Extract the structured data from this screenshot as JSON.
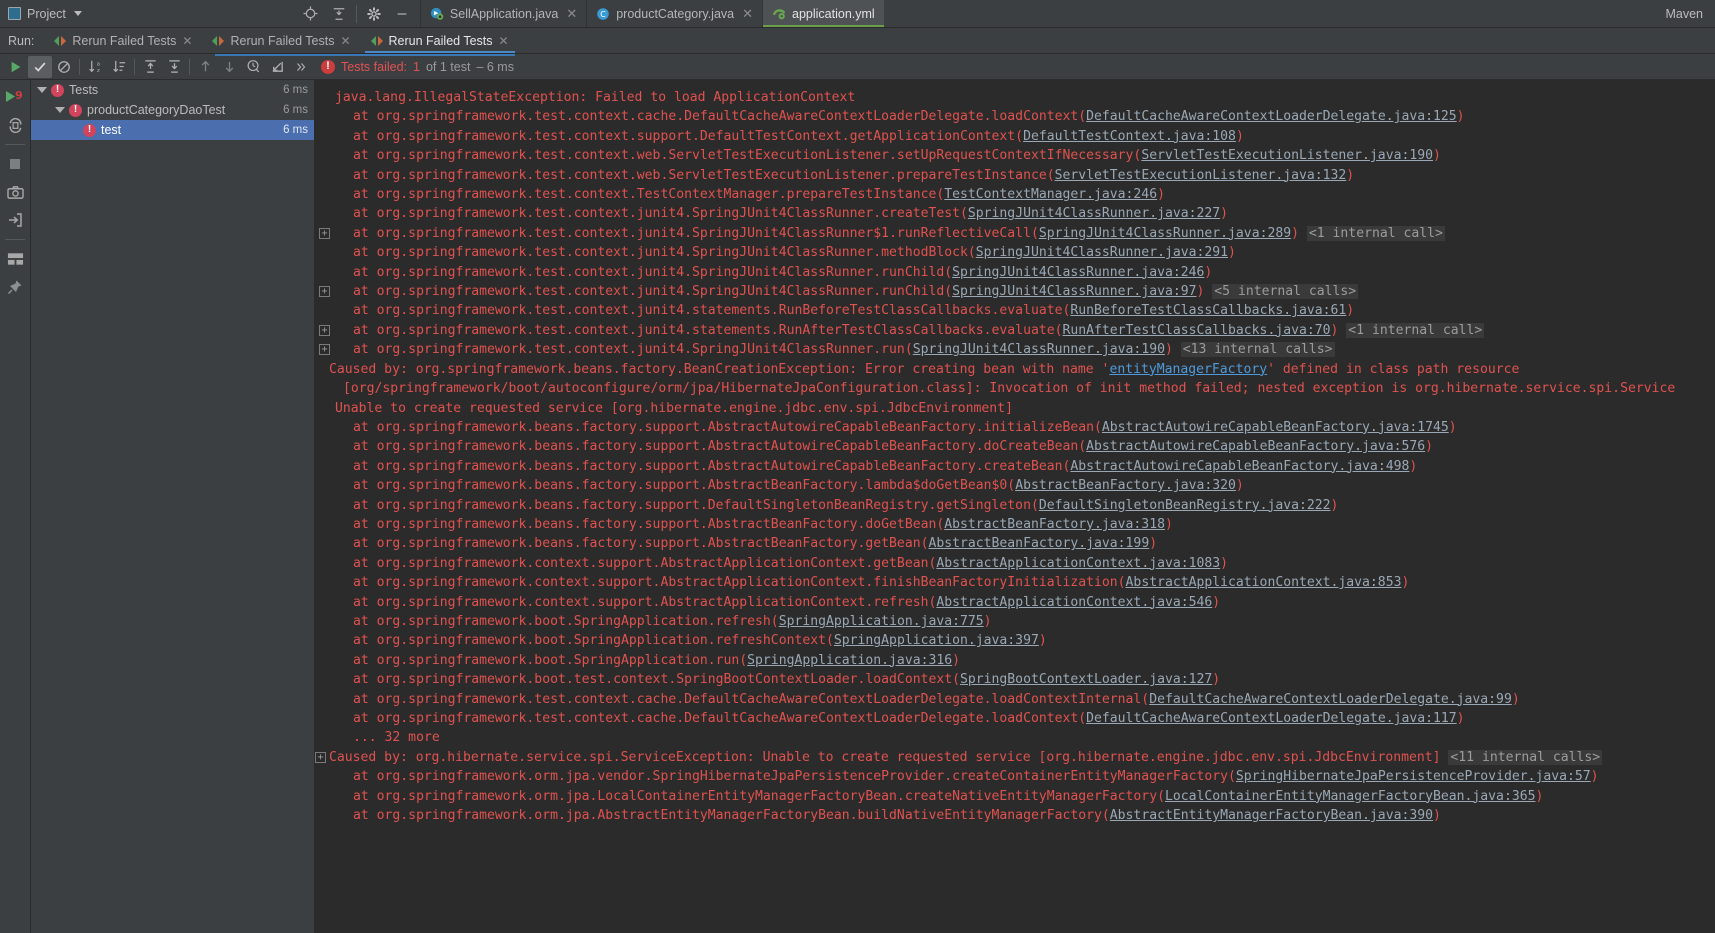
{
  "window": {
    "project_button": "Project",
    "maven_label": "Maven"
  },
  "top_icons": [
    {
      "name": "locate-icon",
      "glyph": "target"
    },
    {
      "name": "collapse-all-icon",
      "glyph": "collapse"
    },
    {
      "name": "settings-gear-icon",
      "glyph": "gear"
    },
    {
      "name": "hide-icon",
      "glyph": "minus"
    }
  ],
  "editor_tabs": [
    {
      "label": "SellApplication.java",
      "icon": "spring-boot-class-icon",
      "active": false,
      "closable": true
    },
    {
      "label": "productCategory.java",
      "icon": "java-class-icon",
      "active": false,
      "closable": true
    },
    {
      "label": "application.yml",
      "icon": "spring-yaml-icon",
      "active": true,
      "closable": false
    }
  ],
  "run_panel": {
    "label": "Run:",
    "tabs": [
      {
        "label": "Rerun Failed Tests",
        "active": false,
        "closable": true
      },
      {
        "label": "Rerun Failed Tests",
        "active": false,
        "closable": true
      },
      {
        "label": "Rerun Failed Tests",
        "active": true,
        "closable": true
      }
    ]
  },
  "toolbar": {
    "buttons": [
      {
        "name": "rerun-button",
        "glyph": "play",
        "selected": false
      },
      {
        "name": "show-passed-toggle",
        "glyph": "check",
        "selected": true
      },
      {
        "name": "show-ignored-toggle",
        "glyph": "no-entry",
        "selected": false
      },
      {
        "name": "sort-alphabetically-button",
        "glyph": "sort-az",
        "selected": false
      },
      {
        "name": "sort-by-duration-button",
        "glyph": "sort-duration",
        "selected": false
      },
      {
        "name": "expand-all-button",
        "glyph": "expand-all",
        "selected": false
      },
      {
        "name": "collapse-all-button",
        "glyph": "collapse-all",
        "selected": false
      },
      {
        "name": "previous-failed-test-button",
        "glyph": "arrow-up",
        "selected": false
      },
      {
        "name": "next-failed-test-button",
        "glyph": "arrow-down",
        "selected": false
      },
      {
        "name": "test-history-button",
        "glyph": "clock",
        "selected": false
      },
      {
        "name": "export-results-button",
        "glyph": "import-arrow",
        "selected": false
      },
      {
        "name": "more-options-button",
        "glyph": "chevrons",
        "selected": false
      }
    ],
    "status_prefix": "Tests failed:",
    "status_count": "1",
    "status_suffix": "of 1 test",
    "status_time": "– 6 ms",
    "error_glyph": "!"
  },
  "side_strip": [
    {
      "name": "run-tool-window-icon",
      "glyph": "run-9"
    },
    {
      "name": "rerun-automatically-icon",
      "glyph": "refresh"
    },
    {
      "name": "stop-process-icon",
      "glyph": "stop-square"
    },
    {
      "name": "screenshot-icon",
      "glyph": "camera"
    },
    {
      "name": "export-icon",
      "glyph": "export"
    },
    {
      "name": "layout-icon",
      "glyph": "layout"
    },
    {
      "name": "pin-tab-icon",
      "glyph": "pin"
    }
  ],
  "test_tree": {
    "rows": [
      {
        "indent": 0,
        "label": "Tests",
        "time": "6 ms",
        "state": "failed",
        "expanded": true,
        "selected": false
      },
      {
        "indent": 1,
        "label": "productCategoryDaoTest",
        "time": "6 ms",
        "state": "failed",
        "expanded": true,
        "selected": false
      },
      {
        "indent": 2,
        "label": "test",
        "time": "6 ms",
        "state": "failed",
        "expanded": false,
        "selected": true
      }
    ]
  },
  "console": {
    "lines": [
      {
        "indent": "ind2",
        "fold": null,
        "segments": [
          {
            "t": "java.lang.IllegalStateException: Failed to load ApplicationContext",
            "c": "err"
          }
        ]
      },
      {
        "indent": "ind2",
        "fold": null,
        "segments": [
          {
            "t": "",
            "c": "err"
          }
        ]
      },
      {
        "indent": "ind1",
        "fold": null,
        "segments": [
          {
            "t": "at org.springframework.test.context.cache.DefaultCacheAwareContextLoaderDelegate.loadContext(",
            "c": "err"
          },
          {
            "t": "DefaultCacheAwareContextLoaderDelegate.java:125",
            "c": "lnk"
          },
          {
            "t": ")",
            "c": "err"
          }
        ]
      },
      {
        "indent": "ind1",
        "fold": null,
        "segments": [
          {
            "t": "at org.springframework.test.context.support.DefaultTestContext.getApplicationContext(",
            "c": "err"
          },
          {
            "t": "DefaultTestContext.java:108",
            "c": "lnk"
          },
          {
            "t": ")",
            "c": "err"
          }
        ]
      },
      {
        "indent": "ind1",
        "fold": null,
        "segments": [
          {
            "t": "at org.springframework.test.context.web.ServletTestExecutionListener.setUpRequestContextIfNecessary(",
            "c": "err"
          },
          {
            "t": "ServletTestExecutionListener.java:190",
            "c": "lnk"
          },
          {
            "t": ")",
            "c": "err"
          }
        ]
      },
      {
        "indent": "ind1",
        "fold": null,
        "segments": [
          {
            "t": "at org.springframework.test.context.web.ServletTestExecutionListener.prepareTestInstance(",
            "c": "err"
          },
          {
            "t": "ServletTestExecutionListener.java:132",
            "c": "lnk"
          },
          {
            "t": ")",
            "c": "err"
          }
        ]
      },
      {
        "indent": "ind1",
        "fold": null,
        "segments": [
          {
            "t": "at org.springframework.test.context.TestContextManager.prepareTestInstance(",
            "c": "err"
          },
          {
            "t": "TestContextManager.java:246",
            "c": "lnk"
          },
          {
            "t": ")",
            "c": "err"
          }
        ]
      },
      {
        "indent": "ind1",
        "fold": null,
        "segments": [
          {
            "t": "at org.springframework.test.context.junit4.SpringJUnit4ClassRunner.createTest(",
            "c": "err"
          },
          {
            "t": "SpringJUnit4ClassRunner.java:227",
            "c": "lnk"
          },
          {
            "t": ")",
            "c": "err"
          }
        ]
      },
      {
        "indent": "ind1",
        "fold": "+",
        "segments": [
          {
            "t": "at org.springframework.test.context.junit4.SpringJUnit4ClassRunner$1.runReflectiveCall(",
            "c": "err"
          },
          {
            "t": "SpringJUnit4ClassRunner.java:289",
            "c": "lnk"
          },
          {
            "t": ") ",
            "c": "err"
          },
          {
            "t": "<1 internal call>",
            "c": "internal"
          }
        ]
      },
      {
        "indent": "ind1",
        "fold": null,
        "segments": [
          {
            "t": "at org.springframework.test.context.junit4.SpringJUnit4ClassRunner.methodBlock(",
            "c": "err"
          },
          {
            "t": "SpringJUnit4ClassRunner.java:291",
            "c": "lnk"
          },
          {
            "t": ")",
            "c": "err"
          }
        ]
      },
      {
        "indent": "ind1",
        "fold": null,
        "segments": [
          {
            "t": "at org.springframework.test.context.junit4.SpringJUnit4ClassRunner.runChild(",
            "c": "err"
          },
          {
            "t": "SpringJUnit4ClassRunner.java:246",
            "c": "lnk"
          },
          {
            "t": ")",
            "c": "err"
          }
        ]
      },
      {
        "indent": "ind1",
        "fold": "+",
        "segments": [
          {
            "t": "at org.springframework.test.context.junit4.SpringJUnit4ClassRunner.runChild(",
            "c": "err"
          },
          {
            "t": "SpringJUnit4ClassRunner.java:97",
            "c": "lnk"
          },
          {
            "t": ") ",
            "c": "err"
          },
          {
            "t": "<5 internal calls>",
            "c": "internal"
          }
        ]
      },
      {
        "indent": "ind1",
        "fold": null,
        "segments": [
          {
            "t": "at org.springframework.test.context.junit4.statements.RunBeforeTestClassCallbacks.evaluate(",
            "c": "err"
          },
          {
            "t": "RunBeforeTestClassCallbacks.java:61",
            "c": "lnk"
          },
          {
            "t": ")",
            "c": "err"
          }
        ]
      },
      {
        "indent": "ind1",
        "fold": "+",
        "segments": [
          {
            "t": "at org.springframework.test.context.junit4.statements.RunAfterTestClassCallbacks.evaluate(",
            "c": "err"
          },
          {
            "t": "RunAfterTestClassCallbacks.java:70",
            "c": "lnk"
          },
          {
            "t": ") ",
            "c": "err"
          },
          {
            "t": "<1 internal call>",
            "c": "internal"
          }
        ]
      },
      {
        "indent": "ind1",
        "fold": "+",
        "segments": [
          {
            "t": "at org.springframework.test.context.junit4.SpringJUnit4ClassRunner.run(",
            "c": "err"
          },
          {
            "t": "SpringJUnit4ClassRunner.java:190",
            "c": "lnk"
          },
          {
            "t": ") ",
            "c": "err"
          },
          {
            "t": "<13 internal calls>",
            "c": "internal"
          }
        ]
      },
      {
        "indent": "caused",
        "fold": null,
        "segments": [
          {
            "t": "Caused by: org.springframework.beans.factory.BeanCreationException: Error creating bean with name '",
            "c": "err"
          },
          {
            "t": "entityManagerFactory",
            "c": "blue"
          },
          {
            "t": "' defined in class path resource",
            "c": "err"
          }
        ]
      },
      {
        "indent": "ind3",
        "fold": null,
        "segments": [
          {
            "t": "[org/springframework/boot/autoconfigure/orm/jpa/HibernateJpaConfiguration.class]: Invocation of init method failed; nested exception is org.hibernate.service.spi.Service",
            "c": "err"
          }
        ]
      },
      {
        "indent": "ind2",
        "fold": null,
        "segments": [
          {
            "t": "Unable to create requested service [org.hibernate.engine.jdbc.env.spi.JdbcEnvironment]",
            "c": "err"
          }
        ]
      },
      {
        "indent": "ind1",
        "fold": null,
        "segments": [
          {
            "t": "at org.springframework.beans.factory.support.AbstractAutowireCapableBeanFactory.initializeBean(",
            "c": "err"
          },
          {
            "t": "AbstractAutowireCapableBeanFactory.java:1745",
            "c": "lnk"
          },
          {
            "t": ")",
            "c": "err"
          }
        ]
      },
      {
        "indent": "ind1",
        "fold": null,
        "segments": [
          {
            "t": "at org.springframework.beans.factory.support.AbstractAutowireCapableBeanFactory.doCreateBean(",
            "c": "err"
          },
          {
            "t": "AbstractAutowireCapableBeanFactory.java:576",
            "c": "lnk"
          },
          {
            "t": ")",
            "c": "err"
          }
        ]
      },
      {
        "indent": "ind1",
        "fold": null,
        "segments": [
          {
            "t": "at org.springframework.beans.factory.support.AbstractAutowireCapableBeanFactory.createBean(",
            "c": "err"
          },
          {
            "t": "AbstractAutowireCapableBeanFactory.java:498",
            "c": "lnk"
          },
          {
            "t": ")",
            "c": "err"
          }
        ]
      },
      {
        "indent": "ind1",
        "fold": null,
        "segments": [
          {
            "t": "at org.springframework.beans.factory.support.AbstractBeanFactory.lambda$doGetBean$0(",
            "c": "err"
          },
          {
            "t": "AbstractBeanFactory.java:320",
            "c": "lnk"
          },
          {
            "t": ")",
            "c": "err"
          }
        ]
      },
      {
        "indent": "ind1",
        "fold": null,
        "segments": [
          {
            "t": "at org.springframework.beans.factory.support.DefaultSingletonBeanRegistry.getSingleton(",
            "c": "err"
          },
          {
            "t": "DefaultSingletonBeanRegistry.java:222",
            "c": "lnk"
          },
          {
            "t": ")",
            "c": "err"
          }
        ]
      },
      {
        "indent": "ind1",
        "fold": null,
        "segments": [
          {
            "t": "at org.springframework.beans.factory.support.AbstractBeanFactory.doGetBean(",
            "c": "err"
          },
          {
            "t": "AbstractBeanFactory.java:318",
            "c": "lnk"
          },
          {
            "t": ")",
            "c": "err"
          }
        ]
      },
      {
        "indent": "ind1",
        "fold": null,
        "segments": [
          {
            "t": "at org.springframework.beans.factory.support.AbstractBeanFactory.getBean(",
            "c": "err"
          },
          {
            "t": "AbstractBeanFactory.java:199",
            "c": "lnk"
          },
          {
            "t": ")",
            "c": "err"
          }
        ]
      },
      {
        "indent": "ind1",
        "fold": null,
        "segments": [
          {
            "t": "at org.springframework.context.support.AbstractApplicationContext.getBean(",
            "c": "err"
          },
          {
            "t": "AbstractApplicationContext.java:1083",
            "c": "lnk"
          },
          {
            "t": ")",
            "c": "err"
          }
        ]
      },
      {
        "indent": "ind1",
        "fold": null,
        "segments": [
          {
            "t": "at org.springframework.context.support.AbstractApplicationContext.finishBeanFactoryInitialization(",
            "c": "err"
          },
          {
            "t": "AbstractApplicationContext.java:853",
            "c": "lnk"
          },
          {
            "t": ")",
            "c": "err"
          }
        ]
      },
      {
        "indent": "ind1",
        "fold": null,
        "segments": [
          {
            "t": "at org.springframework.context.support.AbstractApplicationContext.refresh(",
            "c": "err"
          },
          {
            "t": "AbstractApplicationContext.java:546",
            "c": "lnk"
          },
          {
            "t": ")",
            "c": "err"
          }
        ]
      },
      {
        "indent": "ind1",
        "fold": null,
        "segments": [
          {
            "t": "at org.springframework.boot.SpringApplication.refresh(",
            "c": "err"
          },
          {
            "t": "SpringApplication.java:775",
            "c": "lnk"
          },
          {
            "t": ")",
            "c": "err"
          }
        ]
      },
      {
        "indent": "ind1",
        "fold": null,
        "segments": [
          {
            "t": "at org.springframework.boot.SpringApplication.refreshContext(",
            "c": "err"
          },
          {
            "t": "SpringApplication.java:397",
            "c": "lnk"
          },
          {
            "t": ")",
            "c": "err"
          }
        ]
      },
      {
        "indent": "ind1",
        "fold": null,
        "segments": [
          {
            "t": "at org.springframework.boot.SpringApplication.run(",
            "c": "err"
          },
          {
            "t": "SpringApplication.java:316",
            "c": "lnk"
          },
          {
            "t": ")",
            "c": "err"
          }
        ]
      },
      {
        "indent": "ind1",
        "fold": null,
        "segments": [
          {
            "t": "at org.springframework.boot.test.context.SpringBootContextLoader.loadContext(",
            "c": "err"
          },
          {
            "t": "SpringBootContextLoader.java:127",
            "c": "lnk"
          },
          {
            "t": ")",
            "c": "err"
          }
        ]
      },
      {
        "indent": "ind1",
        "fold": null,
        "segments": [
          {
            "t": "at org.springframework.test.context.cache.DefaultCacheAwareContextLoaderDelegate.loadContextInternal(",
            "c": "err"
          },
          {
            "t": "DefaultCacheAwareContextLoaderDelegate.java:99",
            "c": "lnk"
          },
          {
            "t": ")",
            "c": "err"
          }
        ]
      },
      {
        "indent": "ind1",
        "fold": null,
        "segments": [
          {
            "t": "at org.springframework.test.context.cache.DefaultCacheAwareContextLoaderDelegate.loadContext(",
            "c": "err"
          },
          {
            "t": "DefaultCacheAwareContextLoaderDelegate.java:117",
            "c": "lnk"
          },
          {
            "t": ")",
            "c": "err"
          }
        ]
      },
      {
        "indent": "ind1",
        "fold": null,
        "segments": [
          {
            "t": "... 32 more",
            "c": "err"
          }
        ]
      },
      {
        "indent": "caused0",
        "fold": "+",
        "segments": [
          {
            "t": "Caused by: org.hibernate.service.spi.ServiceException: Unable to create requested service [org.hibernate.engine.jdbc.env.spi.JdbcEnvironment] ",
            "c": "err"
          },
          {
            "t": "<11 internal calls>",
            "c": "internal"
          }
        ]
      },
      {
        "indent": "ind1",
        "fold": null,
        "segments": [
          {
            "t": "at org.springframework.orm.jpa.vendor.SpringHibernateJpaPersistenceProvider.createContainerEntityManagerFactory(",
            "c": "err"
          },
          {
            "t": "SpringHibernateJpaPersistenceProvider.java:57",
            "c": "lnk"
          },
          {
            "t": ")",
            "c": "err"
          }
        ]
      },
      {
        "indent": "ind1",
        "fold": null,
        "segments": [
          {
            "t": "at org.springframework.orm.jpa.LocalContainerEntityManagerFactoryBean.createNativeEntityManagerFactory(",
            "c": "err"
          },
          {
            "t": "LocalContainerEntityManagerFactoryBean.java:365",
            "c": "lnk"
          },
          {
            "t": ")",
            "c": "err"
          }
        ]
      },
      {
        "indent": "ind1",
        "fold": null,
        "segments": [
          {
            "t": "at org.springframework.orm.jpa.AbstractEntityManagerFactoryBean.buildNativeEntityManagerFactory(",
            "c": "err"
          },
          {
            "t": "AbstractEntityManagerFactoryBean.java:390",
            "c": "lnk"
          },
          {
            "t": ")",
            "c": "err"
          }
        ]
      }
    ]
  },
  "colors": {
    "error_red": "#e0524f",
    "link_gray": "#9aa8b5",
    "link_blue": "#4f9ada",
    "selection_blue": "#4b6eaf",
    "console_bg": "#2b2b2b",
    "chrome_bg": "#3c3f41",
    "accent_green": "#6a9e4a"
  }
}
